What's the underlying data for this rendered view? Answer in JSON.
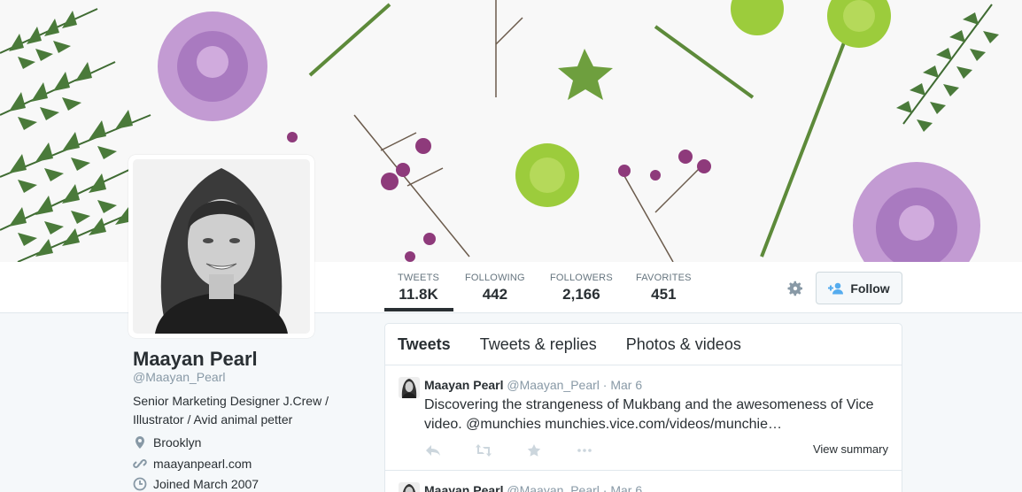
{
  "profile": {
    "name": "Maayan Pearl",
    "handle": "@Maayan_Pearl",
    "bio": "Senior Marketing Designer J.Crew / Illustrator / Avid animal petter",
    "location": "Brooklyn",
    "website": "maayanpearl.com",
    "joined": "Joined March 2007"
  },
  "stats": [
    {
      "label": "TWEETS",
      "value": "11.8K"
    },
    {
      "label": "FOLLOWING",
      "value": "442"
    },
    {
      "label": "FOLLOWERS",
      "value": "2,166"
    },
    {
      "label": "FAVORITES",
      "value": "451"
    }
  ],
  "actions": {
    "follow_label": "Follow",
    "settings_icon": "gear-icon"
  },
  "tabs": [
    {
      "label": "Tweets"
    },
    {
      "label": "Tweets & replies"
    },
    {
      "label": "Photos & videos"
    }
  ],
  "tweets": [
    {
      "name": "Maayan Pearl",
      "handle": "@Maayan_Pearl",
      "date": "· Mar 6",
      "text": "Discovering the strangeness of Mukbang and the awesomeness of Vice video. @munchies munchies.vice.com/videos/munchie…",
      "view_summary": "View summary"
    },
    {
      "name": "Maayan Pearl",
      "handle": "@Maayan_Pearl",
      "date": "· Mar 6"
    }
  ],
  "colors": {
    "background": "#f5f8fa",
    "text": "#292f33",
    "muted": "#8899a6",
    "follow_icon": "#55acee"
  }
}
